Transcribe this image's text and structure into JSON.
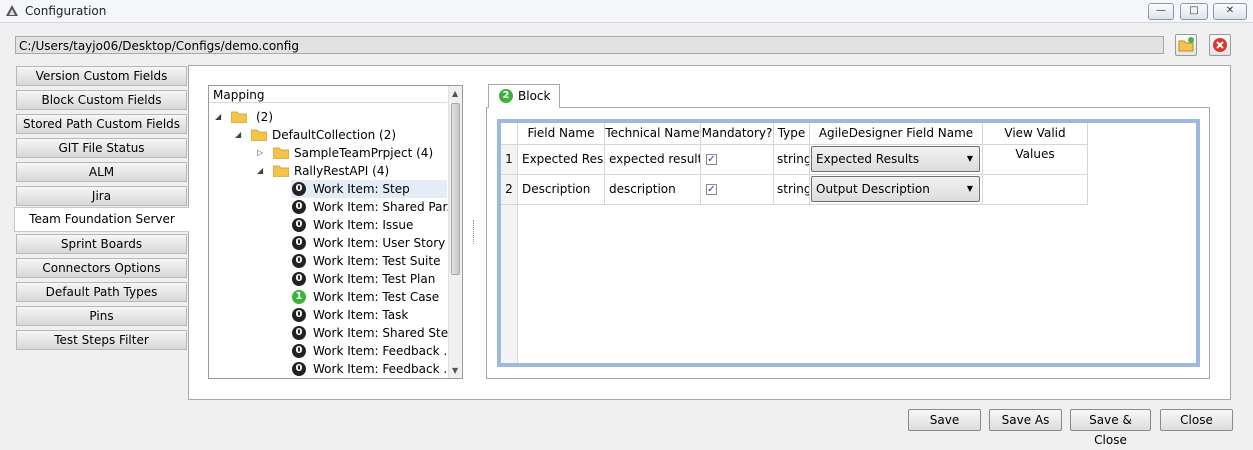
{
  "window": {
    "title": "Configuration",
    "minimize_glyph": "—",
    "maximize_glyph": "□",
    "close_glyph": "✕"
  },
  "path": {
    "value": "C:/Users/tayjo06/Desktop/Configs/demo.config"
  },
  "side_tabs": [
    {
      "label": "Version Custom Fields"
    },
    {
      "label": "Block Custom Fields"
    },
    {
      "label": "Stored Path Custom Fields"
    },
    {
      "label": "GIT File Status"
    },
    {
      "label": "ALM"
    },
    {
      "label": "Jira"
    },
    {
      "label": "Team Foundation Server",
      "active": true
    },
    {
      "label": "Sprint Boards"
    },
    {
      "label": "Connectors Options"
    },
    {
      "label": "Default Path Types"
    },
    {
      "label": "Pins"
    },
    {
      "label": "Test Steps Filter"
    }
  ],
  "tree": {
    "header": "Mapping",
    "root": {
      "label": "(2)"
    },
    "collection": {
      "label": "DefaultCollection (2)"
    },
    "project1": {
      "label": "SampleTeamPrpject (4)"
    },
    "project2": {
      "label": "RallyRestAPI (4)"
    },
    "items": [
      {
        "badge": "0",
        "label": "Work Item: Step",
        "selected": true
      },
      {
        "badge": "0",
        "label": "Work Item: Shared Par..."
      },
      {
        "badge": "0",
        "label": "Work Item: Issue"
      },
      {
        "badge": "0",
        "label": "Work Item: User Story"
      },
      {
        "badge": "0",
        "label": "Work Item: Test Suite"
      },
      {
        "badge": "0",
        "label": "Work Item: Test Plan"
      },
      {
        "badge": "1",
        "label": "Work Item: Test Case",
        "green": true
      },
      {
        "badge": "0",
        "label": "Work Item: Task"
      },
      {
        "badge": "0",
        "label": "Work Item: Shared Steps"
      },
      {
        "badge": "0",
        "label": "Work Item: Feedback ..."
      },
      {
        "badge": "0",
        "label": "Work Item: Feedback ..."
      }
    ]
  },
  "block_tab": {
    "badge": "2",
    "label": "Block"
  },
  "grid": {
    "headers": [
      "Field Name",
      "Technical Name",
      "Mandatory?",
      "Type",
      "AgileDesigner Field Name",
      "View Valid Values"
    ],
    "rows": [
      {
        "num": "1",
        "field_name": "Expected Result",
        "technical_name": "expected result",
        "mandatory": true,
        "type": "string",
        "agile_field": "Expected Results",
        "valid_values": ""
      },
      {
        "num": "2",
        "field_name": "Description",
        "technical_name": "description",
        "mandatory": true,
        "type": "string",
        "agile_field": "Output Description",
        "valid_values": ""
      }
    ]
  },
  "buttons": {
    "save": "Save",
    "save_as": "Save As",
    "save_close": "Save & Close",
    "close": "Close"
  },
  "colors": {
    "badge_dark": "#222222",
    "badge_green": "#3bb33b",
    "grid_frame": "#9db9e0",
    "folder": "#f3c34a",
    "close_icon": "#d9362e"
  },
  "icons": [
    "app-icon",
    "minimize-icon",
    "maximize-icon",
    "close-icon",
    "open-folder-icon",
    "clear-icon",
    "folder-icon",
    "expand-arrow-icon",
    "collapse-arrow-icon",
    "dropdown-arrow-icon",
    "checkmark-icon"
  ]
}
